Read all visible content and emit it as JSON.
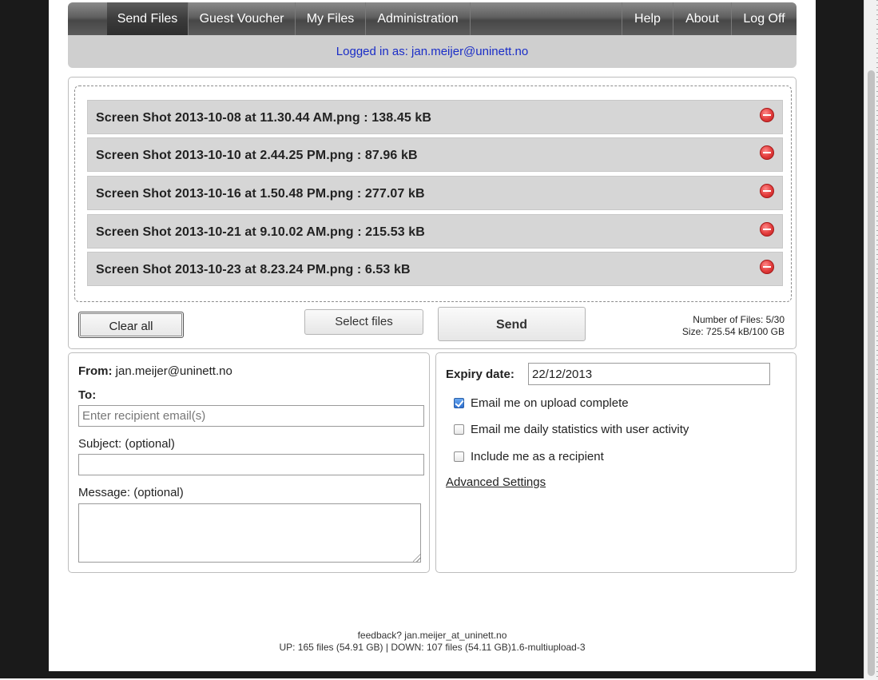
{
  "nav": {
    "left": [
      "Send Files",
      "Guest Voucher",
      "My Files",
      "Administration"
    ],
    "right": [
      "Help",
      "About",
      "Log Off"
    ],
    "active": "Send Files"
  },
  "login": {
    "text": "Logged in as: jan.meijer@uninett.no"
  },
  "files": [
    "Screen Shot 2013-10-08 at 11.30.44 AM.png : 138.45 kB",
    "Screen Shot 2013-10-10 at 2.44.25 PM.png : 87.96 kB",
    "Screen Shot 2013-10-16 at 1.50.48 PM.png : 277.07 kB",
    "Screen Shot 2013-10-21 at 9.10.02 AM.png : 215.53 kB",
    "Screen Shot 2013-10-23 at 8.23.24 PM.png : 6.53 kB"
  ],
  "buttons": {
    "clear_all": "Clear all",
    "select_files": "Select files",
    "send": "Send"
  },
  "stats": {
    "count": "Number of Files: 5/30",
    "size": "Size: 725.54 kB/100 GB"
  },
  "form": {
    "from_label": "From:",
    "from_value": "jan.meijer@uninett.no",
    "to_label": "To:",
    "to_placeholder": "Enter recipient email(s)",
    "subject_label": "Subject: (optional)",
    "subject_value": "",
    "message_label": "Message: (optional)",
    "message_value": ""
  },
  "options": {
    "expiry_label": "Expiry date:",
    "expiry_value": "22/12/2013",
    "checks": [
      {
        "label": "Email me on upload complete",
        "checked": true
      },
      {
        "label": "Email me daily statistics with user activity",
        "checked": false
      },
      {
        "label": "Include me as a recipient",
        "checked": false
      }
    ],
    "advanced": "Advanced Settings"
  },
  "footer": {
    "line1": "feedback? jan.meijer_at_uninett.no",
    "line2": "UP: 165 files (54.91 GB) | DOWN: 107 files (54.11 GB)1.6-multiupload-3"
  },
  "colors": {
    "link_blue": "#1a2dc7",
    "remove_red": "#e23b3b",
    "check_blue": "#2d6fd1"
  }
}
